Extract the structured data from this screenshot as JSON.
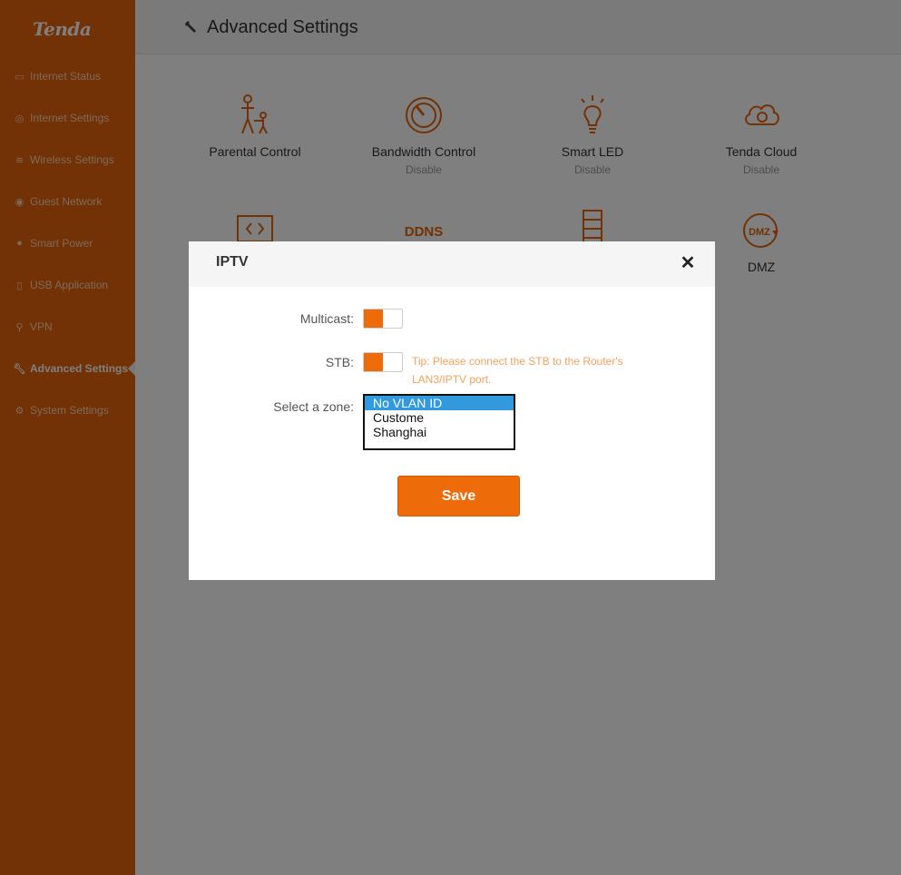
{
  "brand": {
    "logo_text": "Tenda",
    "accent": "#e5640b"
  },
  "sidebar": {
    "items": [
      {
        "label": "Internet Status",
        "icon": "monitor-icon"
      },
      {
        "label": "Internet Settings",
        "icon": "globe-icon"
      },
      {
        "label": "Wireless Settings",
        "icon": "wifi-icon"
      },
      {
        "label": "Guest Network",
        "icon": "guest-icon"
      },
      {
        "label": "Smart Power",
        "icon": "power-pin-icon"
      },
      {
        "label": "USB Application",
        "icon": "usb-icon"
      },
      {
        "label": "VPN",
        "icon": "vpn-icon"
      },
      {
        "label": "Advanced Settings",
        "icon": "wrench-icon",
        "active": true
      },
      {
        "label": "System Settings",
        "icon": "gear-icon"
      }
    ]
  },
  "header": {
    "title": "Advanced Settings"
  },
  "tiles": [
    {
      "label": "Parental Control",
      "sub": ""
    },
    {
      "label": "Bandwidth Control",
      "sub": "Disable"
    },
    {
      "label": "Smart LED",
      "sub": "Disable"
    },
    {
      "label": "Tenda Cloud",
      "sub": "Disable"
    },
    {
      "label": "",
      "sub": ""
    },
    {
      "label": "",
      "sub": "",
      "icon_text": "DDNS"
    },
    {
      "label": "",
      "sub": ""
    },
    {
      "label": "DMZ",
      "sub": "",
      "icon_text": "DMZ"
    }
  ],
  "dialog": {
    "title": "IPTV",
    "close": "✕",
    "multicast_label": "Multicast:",
    "multicast_on": true,
    "stb_label": "STB:",
    "stb_on": true,
    "tip": "Tip: Please connect the STB to the Router's LAN3/IPTV port.",
    "zone_label": "Select a zone:",
    "zone_options": [
      "No VLAN ID",
      "Custome",
      "Shanghai"
    ],
    "zone_selected": "No VLAN ID",
    "save_label": "Save"
  }
}
